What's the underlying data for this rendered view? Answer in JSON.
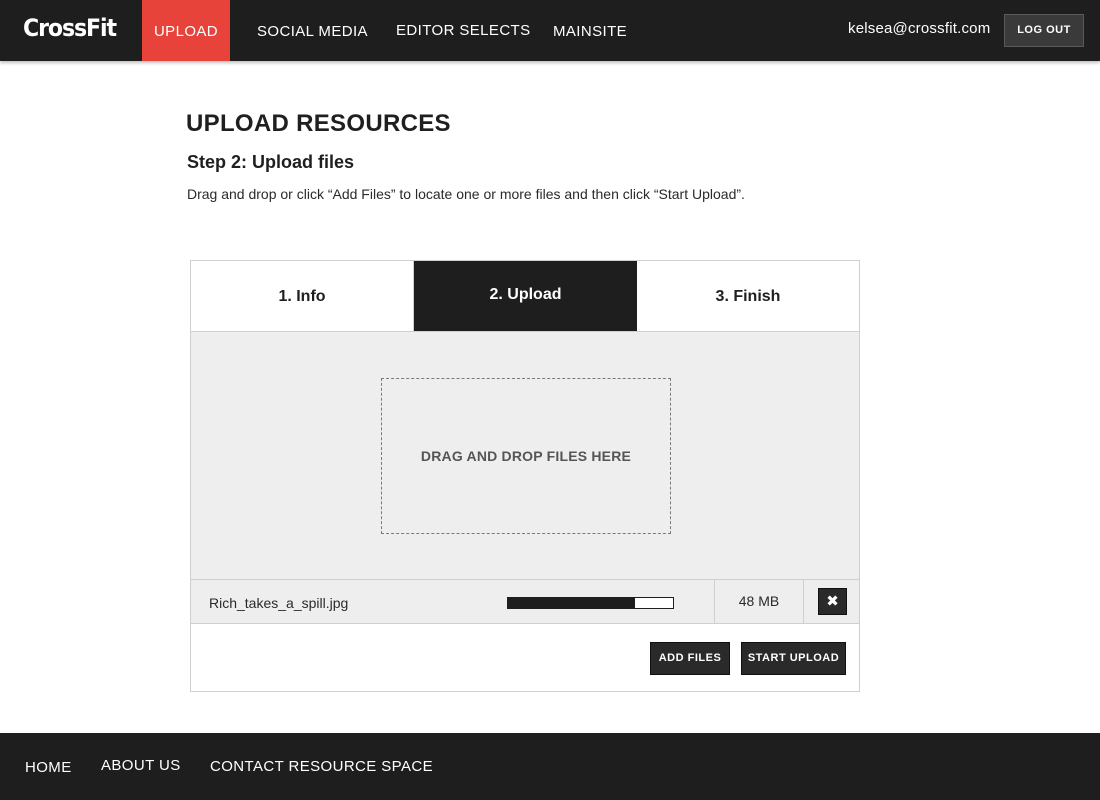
{
  "header": {
    "logo_text": "CrossFit",
    "nav": {
      "upload": "UPLOAD",
      "social_media": "SOCIAL MEDIA",
      "editor_selects": "EDITOR SELECTS",
      "mainsite": "MAINSITE"
    },
    "active_nav": "UPLOAD",
    "user_email": "kelsea@crossfit.com",
    "logout_label": "LOG OUT"
  },
  "page": {
    "title": "UPLOAD RESOURCES",
    "step_title": "Step 2: Upload files",
    "step_description": "Drag and drop or click “Add Files” to locate one or more files and then click “Start Upload”."
  },
  "wizard": {
    "tabs": [
      {
        "label": "1. Info",
        "active": false
      },
      {
        "label": "2. Upload",
        "active": true
      },
      {
        "label": "3. Finish",
        "active": false
      }
    ],
    "dropzone_label": "DRAG AND DROP FILES HERE",
    "files": [
      {
        "name": "Rich_takes_a_spill.jpg",
        "progress": 0.77,
        "size": "48 MB",
        "remove_icon": "close-icon"
      }
    ],
    "add_files_label": "ADD FILES",
    "start_upload_label": "START UPLOAD"
  },
  "footer": {
    "home": "HOME",
    "about": "ABOUT US",
    "contact": "CONTACT RESOURCE SPACE"
  },
  "colors": {
    "header_bg": "#1f1e1e",
    "accent_red": "#e8433a",
    "panel_gray": "#eeeeee"
  }
}
